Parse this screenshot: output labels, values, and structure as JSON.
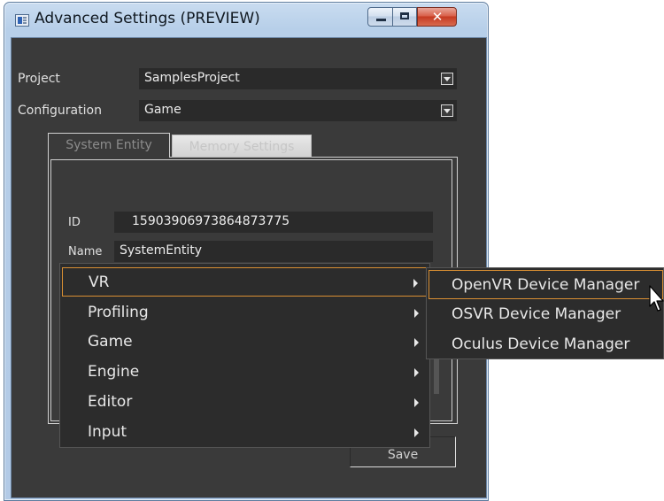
{
  "window": {
    "title": "Advanced Settings (PREVIEW)",
    "controls": {
      "minimize": "minimize-icon",
      "maximize": "maximize-icon",
      "close": "✕"
    }
  },
  "form": {
    "project_label": "Project",
    "project_value": "SamplesProject",
    "configuration_label": "Configuration",
    "configuration_value": "Game"
  },
  "tabs": [
    {
      "label": "System Entity",
      "active": true
    },
    {
      "label": "Memory Settings",
      "active": false
    }
  ],
  "entity": {
    "id_label": "ID",
    "id_value": "15903906973864873775",
    "name_label": "Name",
    "name_value": "SystemEntity"
  },
  "save_label": "Save",
  "context_menu": {
    "items": [
      {
        "label": "VR",
        "highlighted": true
      },
      {
        "label": "Profiling"
      },
      {
        "label": "Game"
      },
      {
        "label": "Engine"
      },
      {
        "label": "Editor"
      },
      {
        "label": "Input"
      }
    ],
    "submenu": [
      {
        "label": "OpenVR Device Manager",
        "highlighted": true
      },
      {
        "label": "OSVR Device Manager"
      },
      {
        "label": "Oculus Device Manager"
      }
    ]
  },
  "colors": {
    "panel_bg": "#3a3a3a",
    "menu_bg": "#2c2c2c",
    "highlight_border": "#d98f33",
    "titlebar": "#b7cfe9"
  }
}
